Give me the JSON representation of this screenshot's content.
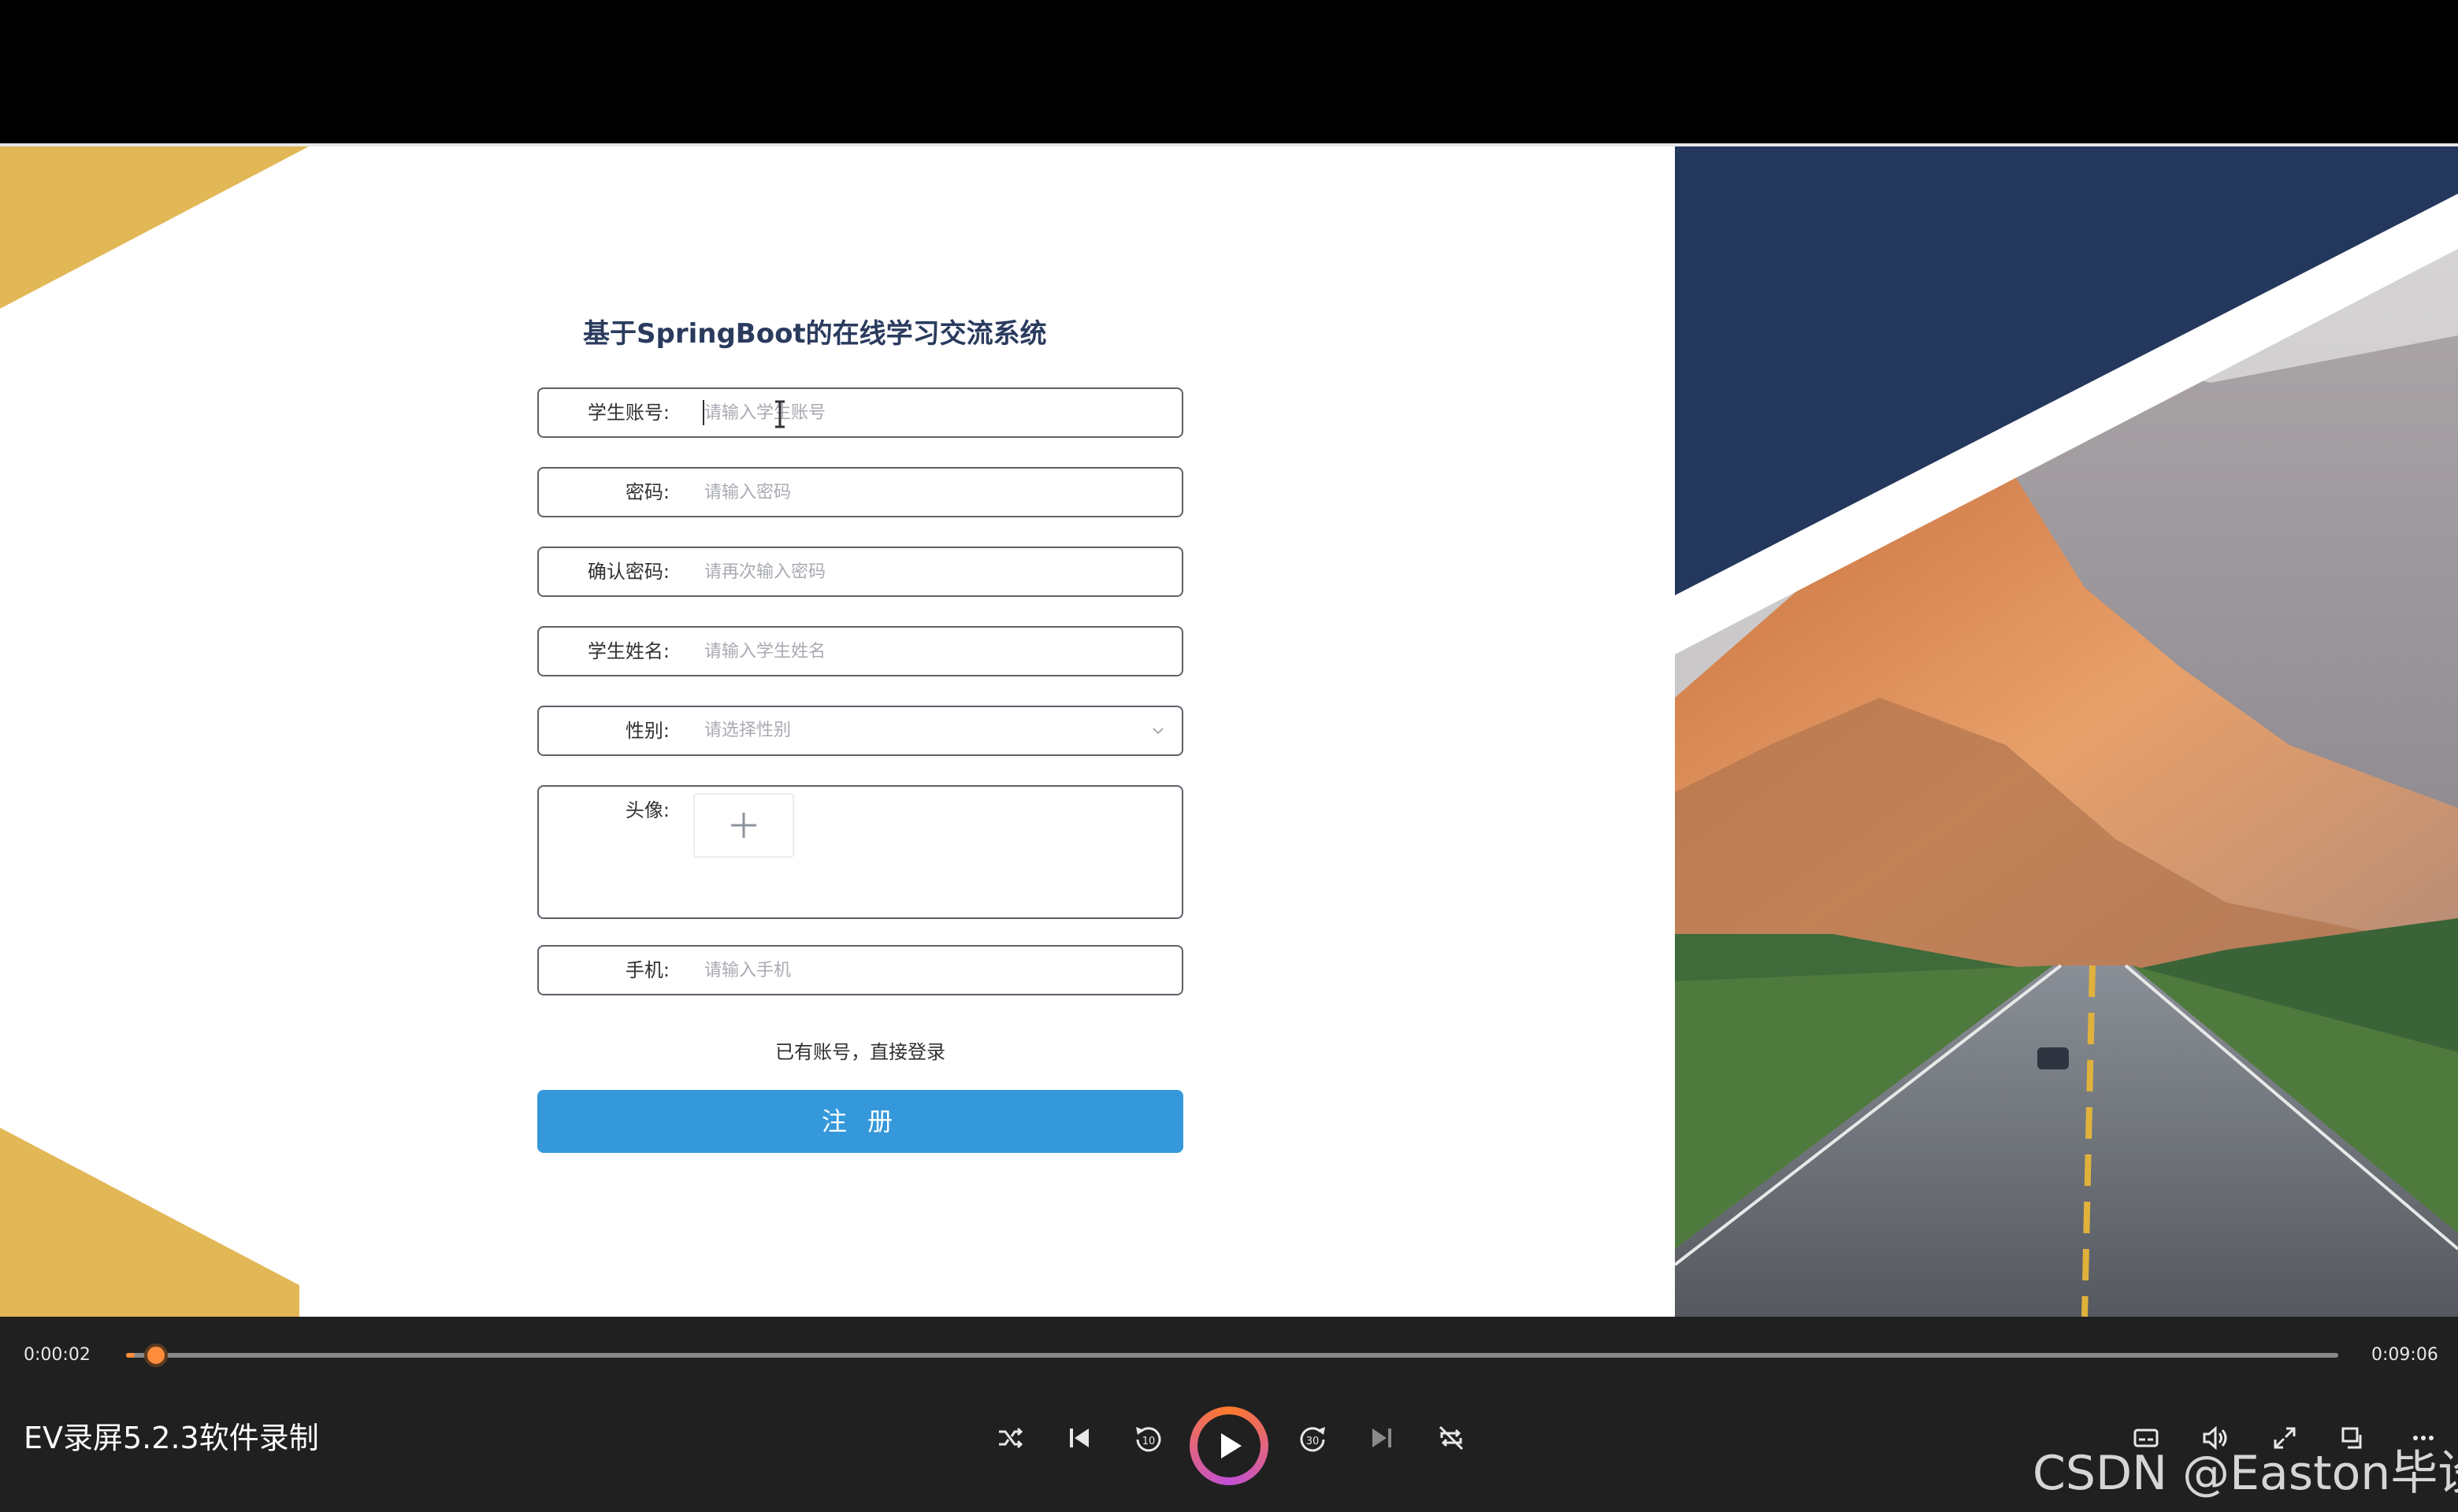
{
  "form": {
    "title": "基于SpringBoot的在线学习交流系统",
    "fields": [
      {
        "label": "学生账号:",
        "placeholder": "请输入学生账号"
      },
      {
        "label": "密码:",
        "placeholder": "请输入密码"
      },
      {
        "label": "确认密码:",
        "placeholder": "请再次输入密码"
      },
      {
        "label": "学生姓名:",
        "placeholder": "请输入学生姓名"
      },
      {
        "label": "性别:",
        "placeholder": "请选择性别"
      },
      {
        "label": "头像:"
      },
      {
        "label": "手机:",
        "placeholder": "请输入手机"
      }
    ],
    "login_link": "已有账号，直接登录",
    "register_label": "注 册"
  },
  "player": {
    "current_time": "0:00:02",
    "total_time": "0:09:06",
    "progress_fraction": 0.004,
    "app_title": "EV录屏5.2.3软件录制",
    "watermark": "CSDN @Easton毕设",
    "accent_color": "#ff8c3a"
  },
  "colors": {
    "gold": "#e2b755",
    "navy": "#24375c",
    "button": "#3498db"
  },
  "icons": [
    "shuffle-icon",
    "previous-icon",
    "rewind-10-icon",
    "play-icon",
    "forward-30-icon",
    "next-icon",
    "repeat-off-icon",
    "subtitles-icon",
    "volume-icon",
    "fullscreen-icon",
    "mini-player-icon",
    "more-icon"
  ]
}
